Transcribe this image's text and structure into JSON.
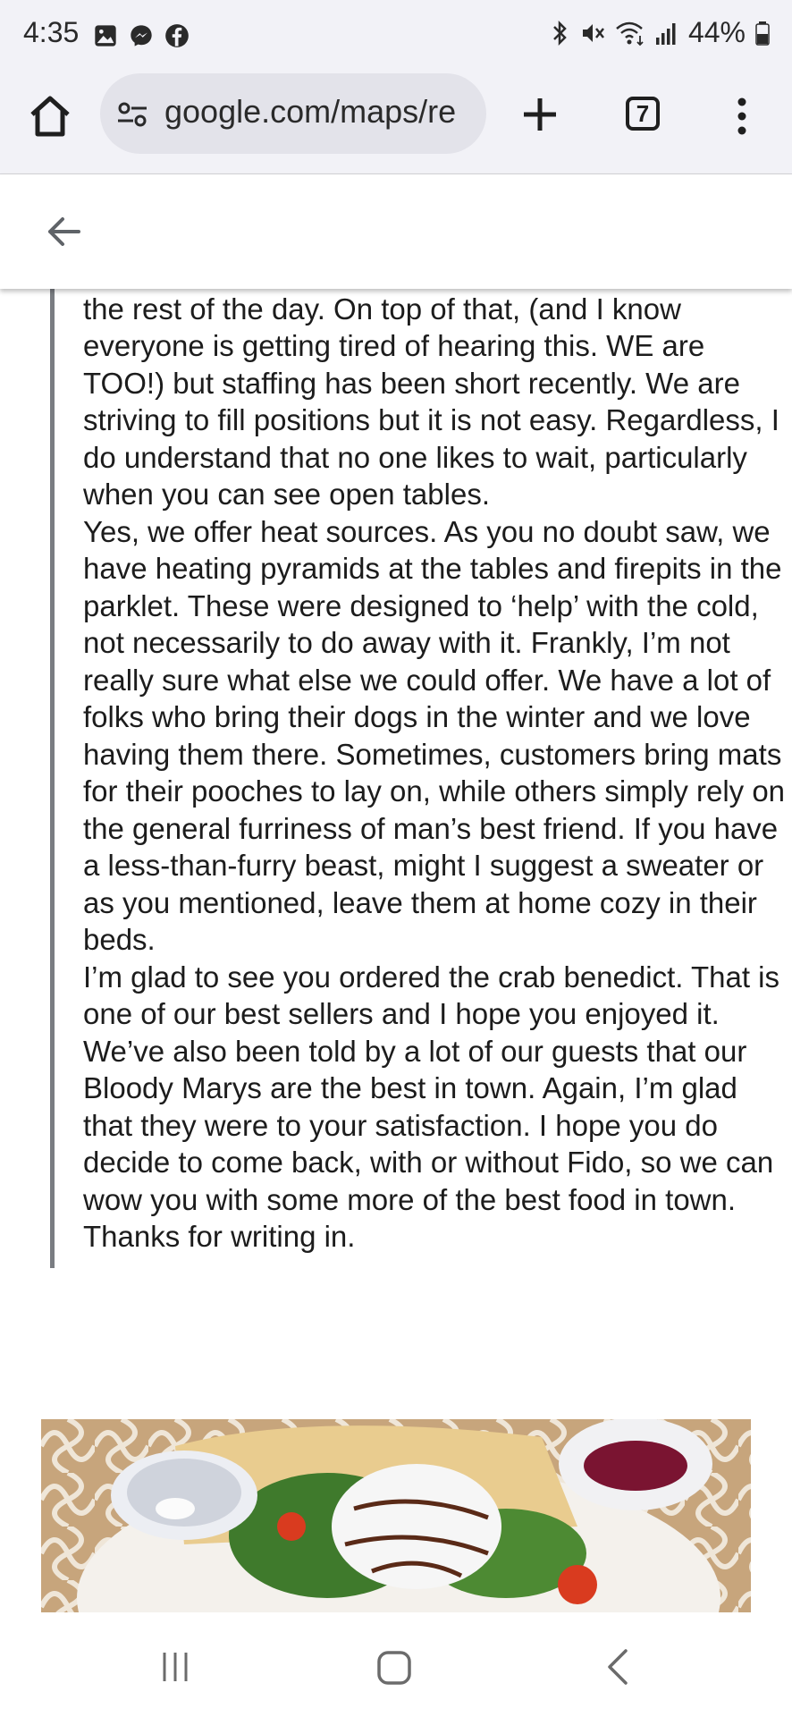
{
  "status_bar": {
    "time": "4:35",
    "battery": "44%",
    "left_icons": [
      "gallery-icon",
      "messenger-icon",
      "facebook-icon"
    ],
    "right_icons": [
      "bluetooth-icon",
      "mute-icon",
      "wifi-icon",
      "signal-icon",
      "battery-icon"
    ]
  },
  "browser": {
    "url": "google.com/maps/re",
    "tab_count": "7"
  },
  "reply": {
    "paragraphs": [
      "we don't have a \"group rush\" to deal with throughout the rest of the day. On top of that, (and I know everyone is getting tired of hearing this. WE are TOO!) but staffing has been short recently.  We are striving to fill positions but it is not easy.  Regardless, I do understand that no one likes to wait, particularly when you can see open tables.",
      "Yes, we offer heat sources.  As you no doubt saw, we have heating pyramids at the tables and firepits in the parklet.  These were designed to ‘help’ with the cold, not necessarily to do away with it.  Frankly, I’m not really sure what else we could offer. We have a lot of folks who bring their dogs in the winter and we love having them there. Sometimes, customers bring mats for their pooches to lay on, while others simply rely on the general furriness of man’s best friend.  If you have a less-than-furry beast, might I suggest a sweater or as you mentioned, leave them at home cozy in their beds.",
      "I’m glad to see you ordered the crab benedict.  That is one of our best sellers and I hope you enjoyed it.  We’ve also been told by a lot of our guests that our Bloody Marys are the best in town. Again, I’m glad that they were to your satisfaction.  I hope you do decide to come back, with or without Fido, so we can wow you with some more of the best food in town.",
      "Thanks for writing in."
    ]
  },
  "photo": {
    "subject": "plate-of-food-photo"
  }
}
